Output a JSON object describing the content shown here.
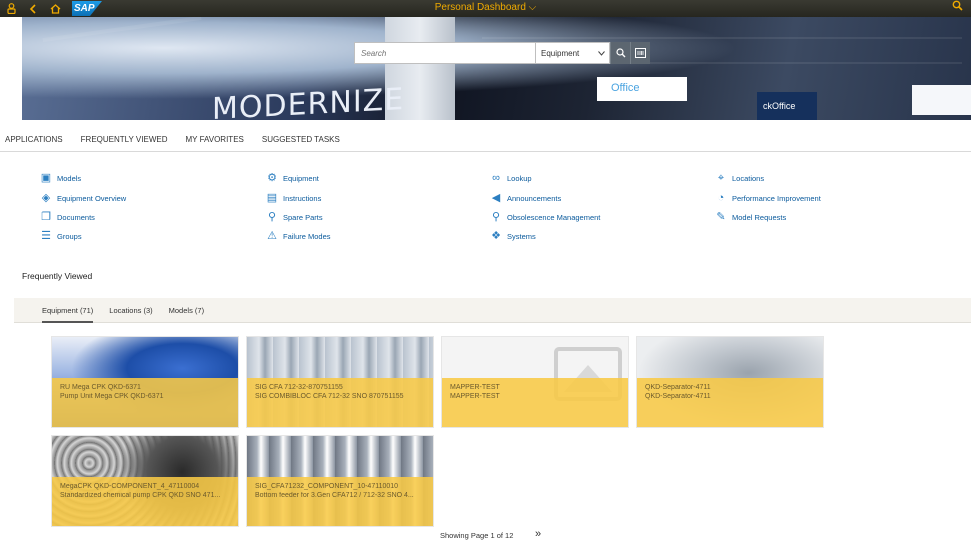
{
  "shell": {
    "title": "Personal Dashboard",
    "title_chevron": "⌵",
    "logo": "SAP",
    "icons": [
      "user-icon",
      "back-icon",
      "home-icon",
      "search-icon"
    ]
  },
  "hero": {
    "banner_text": "MODERNIZE",
    "sign1": "Office",
    "sign2": "ckOffice",
    "search": {
      "placeholder": "Search",
      "scope_selected": "Equipment"
    }
  },
  "tabs": [
    "APPLICATIONS",
    "FREQUENTLY VIEWED",
    "MY FAVORITES",
    "SUGGESTED TASKS"
  ],
  "apps": {
    "col1": [
      {
        "label": "Models",
        "icon": "models-icon"
      },
      {
        "label": "Equipment Overview",
        "icon": "cubes-icon"
      },
      {
        "label": "Documents",
        "icon": "documents-icon"
      },
      {
        "label": "Groups",
        "icon": "list-icon"
      }
    ],
    "col2": [
      {
        "label": "Equipment",
        "icon": "equipment-icon"
      },
      {
        "label": "Instructions",
        "icon": "instructions-icon"
      },
      {
        "label": "Spare Parts",
        "icon": "spare-parts-icon"
      },
      {
        "label": "Failure Modes",
        "icon": "warning-icon"
      }
    ],
    "col3": [
      {
        "label": "Lookup",
        "icon": "binoculars-icon"
      },
      {
        "label": "Announcements",
        "icon": "megaphone-icon"
      },
      {
        "label": "Obsolescence Management",
        "icon": "search-gear-icon"
      },
      {
        "label": "Systems",
        "icon": "systems-icon"
      }
    ],
    "col4": [
      {
        "label": "Locations",
        "icon": "location-pin-icon"
      },
      {
        "label": "Performance Improvement",
        "icon": "gauge-icon"
      },
      {
        "label": "Model Requests",
        "icon": "edit-icon"
      }
    ]
  },
  "frequently_viewed": {
    "title": "Frequently Viewed",
    "tabs": [
      "Equipment (71)",
      "Locations (3)",
      "Models (7)"
    ],
    "cards": [
      {
        "line1": "RU Mega CPK QKD-6371",
        "line2": "Pump Unit Mega CPK QKD-6371"
      },
      {
        "line1": "SIG CFA 712-32-870751155",
        "line2": "SIG COMBIBLOC CFA 712-32 SNO 870751155"
      },
      {
        "line1": "MAPPER-TEST",
        "line2": "MAPPER-TEST"
      },
      {
        "line1": "QKD-Separator-4711",
        "line2": "QKD-Separator-4711"
      },
      {
        "line1": "MegaCPK QKD-COMPONENT_4_47110004",
        "line2": "Standardized chemical pump CPK QKD SNO 471..."
      },
      {
        "line1": "SIG_CFA71232_COMPONENT_10-47110010",
        "line2": "Bottom feeder for 3.Gen CFA712 / 712-32 SNO 4..."
      }
    ],
    "pager": "Showing Page 1 of 12",
    "pager_next": "»"
  },
  "colors": {
    "shell_bg": "#2f2f28",
    "shell_accent": "#f0ab00",
    "link": "#0a5a9c",
    "card_caption": "#f8ca46"
  }
}
